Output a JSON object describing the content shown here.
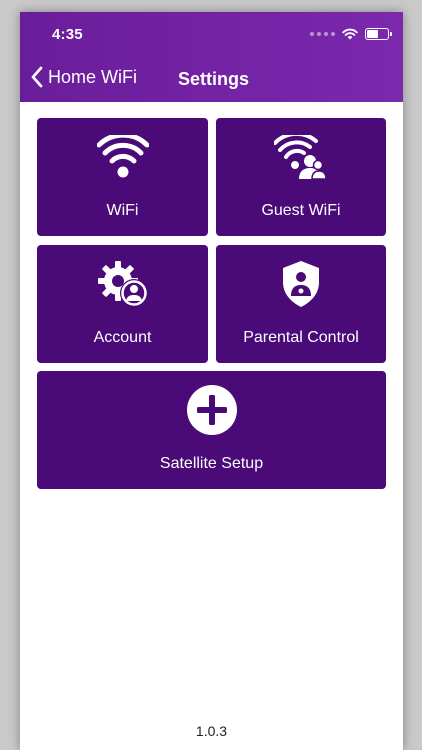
{
  "status_bar": {
    "time": "4:35"
  },
  "nav": {
    "back_label": "Home WiFi",
    "title": "Settings"
  },
  "tiles": [
    {
      "label": "WiFi",
      "icon": "wifi-icon"
    },
    {
      "label": "Guest WiFi",
      "icon": "guest-wifi-icon"
    },
    {
      "label": "Account",
      "icon": "account-gear-icon"
    },
    {
      "label": "Parental Control",
      "icon": "shield-person-icon"
    },
    {
      "label": "Satellite Setup",
      "icon": "plus-circle-icon"
    }
  ],
  "footer": {
    "version": "1.0.3"
  },
  "colors": {
    "header": "#7326a6",
    "tile": "#4a0a78",
    "text_on_tile": "#ffffff"
  }
}
